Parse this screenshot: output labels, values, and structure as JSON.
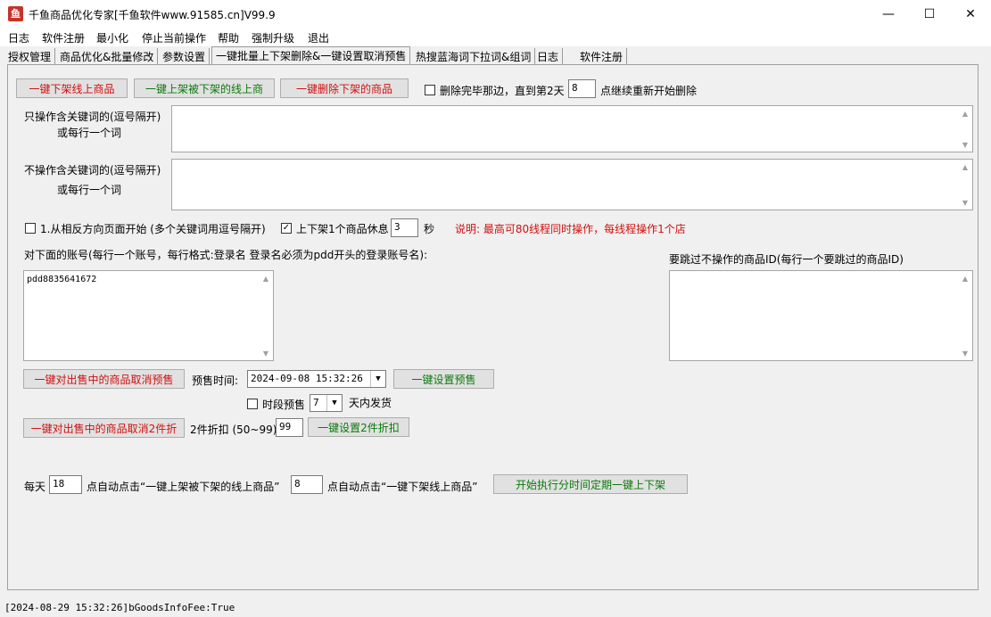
{
  "window": {
    "title": "千鱼商品优化专家[千鱼软件www.91585.cn]V99.9",
    "app_icon_glyph": "鱼",
    "min_glyph": "—",
    "max_glyph": "☐",
    "close_glyph": "✕"
  },
  "menu": [
    "日志",
    "软件注册",
    "最小化",
    "停止当前操作",
    "帮助",
    "强制升级",
    "退出"
  ],
  "tabs": [
    {
      "label": "授权管理",
      "active": false
    },
    {
      "label": "商品优化&批量修改",
      "active": false
    },
    {
      "label": "参数设置",
      "active": false
    },
    {
      "label": "一键批量上下架删除&一键设置取消预售",
      "active": true
    },
    {
      "label": "热搜蓝海词下拉词&组词",
      "active": false
    },
    {
      "label": "日志",
      "active": false
    },
    {
      "label": "软件注册",
      "active": false
    }
  ],
  "top_buttons": {
    "off_shelf": "一键下架线上商品",
    "on_shelf": "一键上架被下架的线上商",
    "delete": "一键删除下架的商品"
  },
  "delete_option": {
    "label_before": "删除完毕那边，直到第2天",
    "value": "8",
    "label_after": "点继续重新开始删除",
    "checked": false
  },
  "include_keywords": {
    "label_line1": "只操作含关键词的(逗号隔开)",
    "label_line2": "或每行一个词",
    "value": ""
  },
  "exclude_keywords": {
    "label_line1": "不操作含关键词的(逗号隔开)",
    "label_line2": "或每行一个词",
    "value": ""
  },
  "options": {
    "reverse_label": "1.从相反方向页面开始 (多个关键词用逗号隔开)",
    "reverse_checked": false,
    "rest_label": "上下架1个商品休息",
    "rest_checked": true,
    "rest_value": "3",
    "rest_unit": "秒",
    "note": "说明: 最高可80线程同时操作，每线程操作1个店"
  },
  "accounts": {
    "label": "对下面的账号(每行一个账号，每行格式:登录名  登录名必须为pdd开头的登录账号名):",
    "value": "pdd8835641672"
  },
  "skip_ids": {
    "label": "要跳过不操作的商品ID(每行一个要跳过的商品ID)",
    "value": ""
  },
  "presale": {
    "cancel_button": "一键对出售中的商品取消预售",
    "time_label": "预售时间:",
    "time_value": "2024-09-08 15:32:26",
    "set_button": "一键设置预售",
    "period_label": "时段预售",
    "period_checked": false,
    "days_value": "7",
    "days_label": "天内发货"
  },
  "discount": {
    "cancel_button": "一键对出售中的商品取消2件折",
    "label": "2件折扣 (50~99)",
    "value": "99",
    "set_button": "一键设置2件折扣"
  },
  "schedule": {
    "label_daily": "每天",
    "on_hour": "18",
    "on_label": "点自动点击“一键上架被下架的线上商品”",
    "off_hour": "8",
    "off_label": "点自动点击“一键下架线上商品”",
    "start_button": "开始执行分时间定期一键上下架"
  },
  "status": {
    "text": "[2024-08-29 15:32:26]bGoodsInfoFee:True"
  }
}
